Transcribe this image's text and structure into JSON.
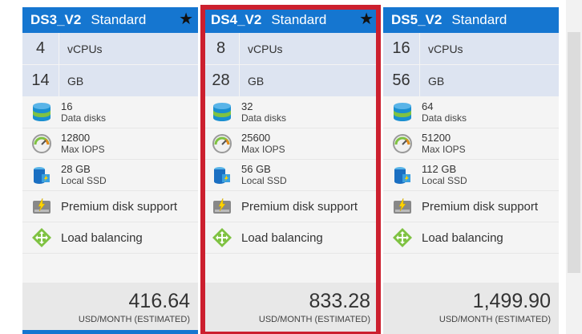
{
  "cards": [
    {
      "name": "DS3_V2",
      "tier": "Standard",
      "starred": true,
      "selected": false,
      "vcpus": "4",
      "vcpus_unit": "vCPUs",
      "memory": "14",
      "memory_unit": "GB",
      "data_disks": "16",
      "data_disks_label": "Data disks",
      "max_iops": "12800",
      "max_iops_label": "Max IOPS",
      "local_ssd": "28 GB",
      "local_ssd_label": "Local SSD",
      "premium": "Premium disk support",
      "lb": "Load balancing",
      "price": "416.64",
      "price_label": "USD/MONTH (ESTIMATED)"
    },
    {
      "name": "DS4_V2",
      "tier": "Standard",
      "starred": true,
      "selected": true,
      "vcpus": "8",
      "vcpus_unit": "vCPUs",
      "memory": "28",
      "memory_unit": "GB",
      "data_disks": "32",
      "data_disks_label": "Data disks",
      "max_iops": "25600",
      "max_iops_label": "Max IOPS",
      "local_ssd": "56 GB",
      "local_ssd_label": "Local SSD",
      "premium": "Premium disk support",
      "lb": "Load balancing",
      "price": "833.28",
      "price_label": "USD/MONTH (ESTIMATED)"
    },
    {
      "name": "DS5_V2",
      "tier": "Standard",
      "starred": false,
      "selected": false,
      "vcpus": "16",
      "vcpus_unit": "vCPUs",
      "memory": "56",
      "memory_unit": "GB",
      "data_disks": "64",
      "data_disks_label": "Data disks",
      "max_iops": "51200",
      "max_iops_label": "Max IOPS",
      "local_ssd": "112 GB",
      "local_ssd_label": "Local SSD",
      "premium": "Premium disk support",
      "lb": "Load balancing",
      "price": "1,499.90",
      "price_label": "USD/MONTH (ESTIMATED)"
    }
  ],
  "icons": {
    "star": "star-icon",
    "data_disks": "stacked-disks-icon",
    "iops": "gauge-icon",
    "ssd": "ssd-drive-icon",
    "premium": "premium-disk-icon",
    "lb": "load-balancer-icon"
  },
  "colors": {
    "header_blue": "#1576d0",
    "selected_border": "#cc1f2e",
    "stat_row_bg": "#dde4f1"
  }
}
